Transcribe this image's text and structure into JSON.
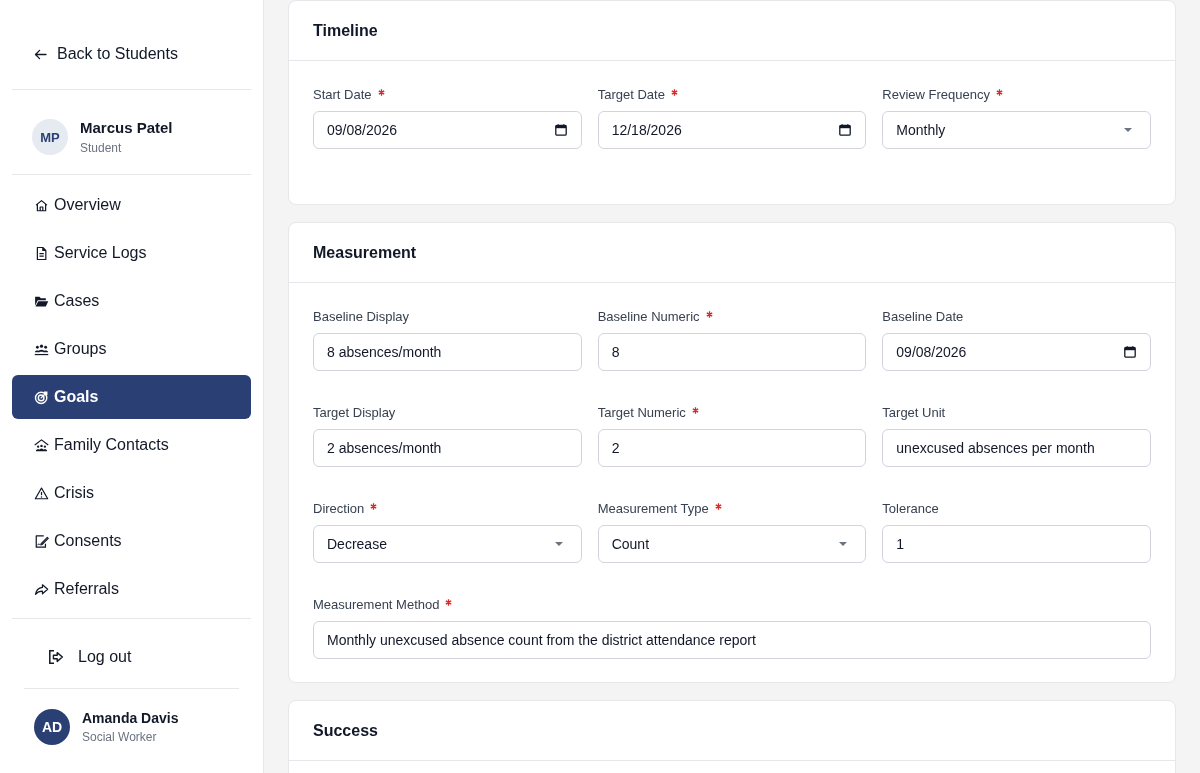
{
  "sidebar": {
    "back_link": "Back to Students",
    "student": {
      "initials": "MP",
      "name": "Marcus Patel",
      "role": "Student"
    },
    "nav_items": [
      {
        "label": "Overview",
        "selected": false
      },
      {
        "label": "Service Logs",
        "selected": false
      },
      {
        "label": "Cases",
        "selected": false
      },
      {
        "label": "Groups",
        "selected": false
      },
      {
        "label": "Goals",
        "selected": true
      },
      {
        "label": "Family Contacts",
        "selected": false
      },
      {
        "label": "Crisis",
        "selected": false
      },
      {
        "label": "Consents",
        "selected": false
      },
      {
        "label": "Referrals",
        "selected": false
      }
    ],
    "logout": "Log out",
    "user": {
      "initials": "AD",
      "name": "Amanda Davis",
      "role": "Social Worker"
    }
  },
  "sections": [
    {
      "title": "Timeline",
      "rows": [
        [
          {
            "label": "Start Date",
            "required": true,
            "kind": "date",
            "value": "09/08/2026"
          },
          {
            "label": "Target Date",
            "required": true,
            "kind": "date",
            "value": "12/18/2026"
          },
          {
            "label": "Review Frequency",
            "required": true,
            "kind": "select",
            "value": "Monthly"
          }
        ]
      ]
    },
    {
      "title": "Measurement",
      "rows": [
        [
          {
            "label": "Baseline Display",
            "required": false,
            "kind": "text",
            "value": "8 absences/month"
          },
          {
            "label": "Baseline Numeric",
            "required": true,
            "kind": "text",
            "value": "8"
          },
          {
            "label": "Baseline Date",
            "required": false,
            "kind": "date",
            "value": "09/08/2026"
          }
        ],
        [
          {
            "label": "Target Display",
            "required": false,
            "kind": "text",
            "value": "2 absences/month"
          },
          {
            "label": "Target Numeric",
            "required": true,
            "kind": "text",
            "value": "2"
          },
          {
            "label": "Target Unit",
            "required": false,
            "kind": "text",
            "value": "unexcused absences per month"
          }
        ],
        [
          {
            "label": "Direction",
            "required": true,
            "kind": "select",
            "value": "Decrease"
          },
          {
            "label": "Measurement Type",
            "required": true,
            "kind": "select",
            "value": "Count"
          },
          {
            "label": "Tolerance",
            "required": false,
            "kind": "text",
            "value": "1"
          }
        ],
        [
          {
            "label": "Measurement Method",
            "required": true,
            "kind": "text",
            "value": "Monthly unexcused absence count from the district attendance report"
          }
        ]
      ]
    },
    {
      "title": "Success"
    }
  ]
}
